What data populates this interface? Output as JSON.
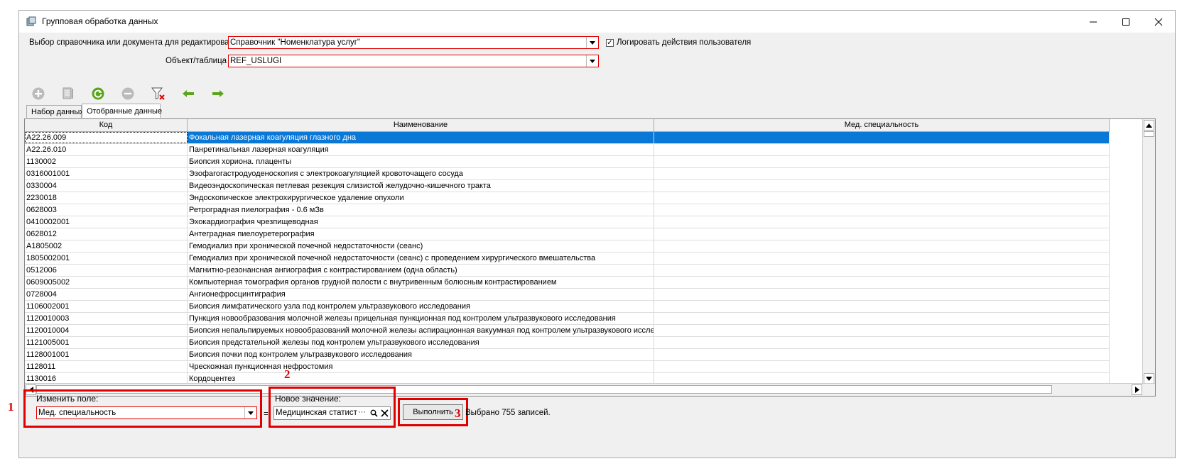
{
  "window": {
    "title": "Групповая обработка данных",
    "controls": {
      "minimize": "minimize-icon",
      "maximize": "maximize-icon",
      "close": "close-icon"
    }
  },
  "form": {
    "source_label": "Выбор справочника или документа для редактирования",
    "source_value": "Справочник \"Номенклатура услуг\"",
    "log_checkbox_label": "Логировать действия пользователя",
    "log_checked": true,
    "object_label": "Объект/таблица",
    "object_value": "REF_USLUGI"
  },
  "toolbar": [
    "add-icon",
    "edit-doc-icon",
    "refresh-icon",
    "remove-icon",
    "clear-filter-icon",
    "arrow-left-icon",
    "arrow-right-icon"
  ],
  "tabs": [
    {
      "label": "Набор данных",
      "active": false
    },
    {
      "label": "Отобранные данные",
      "active": true
    }
  ],
  "grid": {
    "columns": [
      "Код",
      "Наименование",
      "Мед. специальность"
    ],
    "rows": [
      {
        "code": "A22.26.009",
        "name": "Фокальная лазерная коагуляция глазного дна",
        "spec": ""
      },
      {
        "code": "A22.26.010",
        "name": "Панретинальная лазерная коагуляция",
        "spec": ""
      },
      {
        "code": "1130002",
        "name": "Биопсия хориона. плаценты",
        "spec": ""
      },
      {
        "code": "0316001001",
        "name": "Эзофагогастродуоденоскопия с электрокоагуляцией кровоточащего сосуда",
        "spec": ""
      },
      {
        "code": "0330004",
        "name": "Видеоэндоскопическая петлевая резекция слизистой желудочно-кишечного тракта",
        "spec": ""
      },
      {
        "code": "2230018",
        "name": "Эндоскопическое электрохирургическое удаление опухоли",
        "spec": ""
      },
      {
        "code": "0628003",
        "name": "Ретроградная пиелография - 0.6 мЗв",
        "spec": ""
      },
      {
        "code": "0410002001",
        "name": "Эхокардиография чрезпищеводная",
        "spec": ""
      },
      {
        "code": "0628012",
        "name": "Антеградная пиелоуретерография",
        "spec": ""
      },
      {
        "code": "A1805002",
        "name": "Гемодиализ при хронической почечной недостаточности (сеанс)",
        "spec": ""
      },
      {
        "code": "1805002001",
        "name": "Гемодиализ при хронической почечной недостаточности   (сеанс) с проведением   хирургического вмешательства",
        "spec": ""
      },
      {
        "code": "0512006",
        "name": "Магнитно-резонансная ангиография с контрастированием (одна область)",
        "spec": ""
      },
      {
        "code": "0609005002",
        "name": "Компьютерная томография органов грудной полости с внутривенным болюсным контрастированием",
        "spec": ""
      },
      {
        "code": "0728004",
        "name": "Ангионефросцинтиграфия",
        "spec": ""
      },
      {
        "code": "1106002001",
        "name": "Биопсия лимфатического узла под контролем ультразвукового исследования",
        "spec": ""
      },
      {
        "code": "1120010003",
        "name": "Пункция новообразования молочной железы прицельная пункционная под контролем ультразвукового исследования",
        "spec": ""
      },
      {
        "code": "1120010004",
        "name": "Биопсия непальпируемых новообразований молочной железы аспирационная вакуумная под контролем ультразвукового исследования",
        "spec": ""
      },
      {
        "code": "1121005001",
        "name": "Биопсия предстательной железы под контролем ультразвукового исследования",
        "spec": ""
      },
      {
        "code": "1128001001",
        "name": "Биопсия почки под контролем ультразвукового исследования",
        "spec": ""
      },
      {
        "code": "1128011",
        "name": "Чрескожная пункционная нефростомия",
        "spec": ""
      },
      {
        "code": "1130016",
        "name": "Кордоцентез",
        "spec": ""
      }
    ]
  },
  "bottom": {
    "change_field_label": "Изменить поле:",
    "change_field_value": "Мед. специальность",
    "equals": "=",
    "new_value_label": "Новое значение:",
    "new_value": "Медицинская статист",
    "new_value_ellipsis": "···",
    "execute_label": "Выполнить",
    "status": "Выбрано 755 записей."
  },
  "annotations": [
    "1",
    "2",
    "3"
  ],
  "colors": {
    "highlight": "#e00000",
    "selection": "#0a78d7",
    "green_icon": "#5aa51e"
  }
}
